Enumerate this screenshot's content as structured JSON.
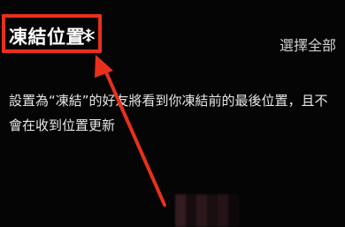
{
  "header": {
    "title": "凍結位置",
    "title_icon": "snowflake-icon",
    "select_all_label": "選擇全部"
  },
  "description": {
    "text": "設置為“凍結”的好友將看到你凍結前的最後位置，且不會在收到位置更新"
  },
  "annotation": {
    "highlight_color": "#e8301c",
    "arrow_color": "#e8301c"
  }
}
